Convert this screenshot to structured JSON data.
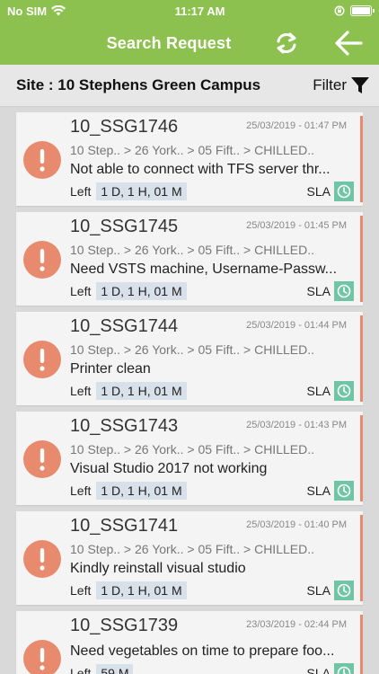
{
  "status_bar": {
    "carrier": "No SIM",
    "time": "11:17 AM"
  },
  "header": {
    "title": "Search Request"
  },
  "site_bar": {
    "label": "Site : ",
    "value": "10 Stephens Green Campus",
    "filter_label": "Filter"
  },
  "colors": {
    "header_green": "#8dc14f",
    "alert_orange": "#e88a6d",
    "sla_green": "#6fc5a5"
  },
  "requests": [
    {
      "id": "10_SSG1746",
      "date": "25/03/2019 - 01:47 PM",
      "path": "10 Step.. > 26 York.. > 05 Fift.. > CHILLED..",
      "description": "Not able to connect with TFS server thr...",
      "left_label": "Left",
      "left_value": "1 D, 1 H, 01 M",
      "sla_label": "SLA"
    },
    {
      "id": "10_SSG1745",
      "date": "25/03/2019 - 01:45 PM",
      "path": "10 Step.. > 26 York.. > 05 Fift.. > CHILLED..",
      "description": "Need VSTS machine, Username-Passw...",
      "left_label": "Left",
      "left_value": "1 D, 1 H, 01 M",
      "sla_label": "SLA"
    },
    {
      "id": "10_SSG1744",
      "date": "25/03/2019 - 01:44 PM",
      "path": "10 Step.. > 26 York.. > 05 Fift.. > CHILLED..",
      "description": "Printer clean",
      "left_label": "Left",
      "left_value": "1 D, 1 H, 01 M",
      "sla_label": "SLA"
    },
    {
      "id": "10_SSG1743",
      "date": "25/03/2019 - 01:43 PM",
      "path": "10 Step.. > 26 York.. > 05 Fift.. > CHILLED..",
      "description": "Visual Studio 2017 not working",
      "left_label": "Left",
      "left_value": "1 D, 1 H, 01 M",
      "sla_label": "SLA"
    },
    {
      "id": "10_SSG1741",
      "date": "25/03/2019 - 01:40 PM",
      "path": "10 Step.. > 26 York.. > 05 Fift.. > CHILLED..",
      "description": "Kindly reinstall visual studio",
      "left_label": "Left",
      "left_value": "1 D, 1 H, 01 M",
      "sla_label": "SLA"
    },
    {
      "id": "10_SSG1739",
      "date": "23/03/2019 - 02:44 PM",
      "path": "",
      "description": "Need vegetables on time to prepare foo...",
      "left_label": "Left",
      "left_value": "59 M",
      "sla_label": "SLA"
    }
  ]
}
